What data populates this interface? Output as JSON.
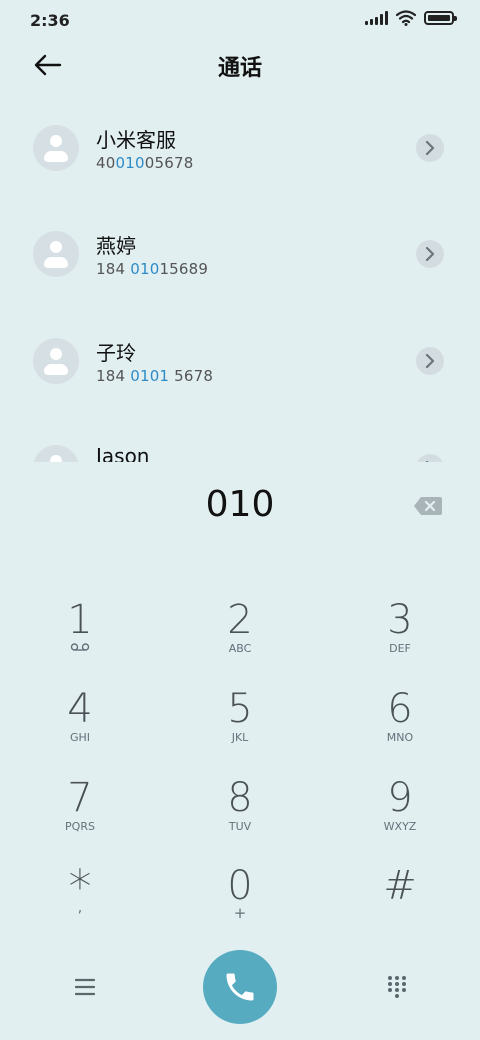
{
  "status_bar": {
    "time": "2:36",
    "battery_level": 1.0
  },
  "header": {
    "title": "通话"
  },
  "contacts": [
    {
      "name": "小米客服",
      "number_pre": "40",
      "number_hl": "010",
      "number_post": "05678"
    },
    {
      "name": "燕婷",
      "number_pre": "184 ",
      "number_hl": "010",
      "number_post": "15689"
    },
    {
      "name": "子玲",
      "number_pre": "184 ",
      "number_hl": "0101",
      "number_post": " 5678"
    },
    {
      "name": "Jason",
      "number_pre": "",
      "number_hl": "",
      "number_post": ""
    }
  ],
  "dialer": {
    "value": "010"
  },
  "keypad": [
    {
      "digit": "1",
      "letters": ""
    },
    {
      "digit": "2",
      "letters": "ABC"
    },
    {
      "digit": "3",
      "letters": "DEF"
    },
    {
      "digit": "4",
      "letters": "GHI"
    },
    {
      "digit": "5",
      "letters": "JKL"
    },
    {
      "digit": "6",
      "letters": "MNO"
    },
    {
      "digit": "7",
      "letters": "PQRS"
    },
    {
      "digit": "8",
      "letters": "TUV"
    },
    {
      "digit": "9",
      "letters": "WXYZ"
    },
    {
      "digit": "*",
      "letters": ","
    },
    {
      "digit": "0",
      "letters": "+"
    },
    {
      "digit": "#",
      "letters": ""
    }
  ],
  "icons": {
    "back": "arrow-left-icon",
    "voicemail": "voicemail-icon",
    "backspace": "backspace-icon",
    "menu": "menu-icon",
    "call": "phone-icon",
    "keypad_toggle": "dialpad-icon"
  },
  "colors": {
    "background": "#e1eff1",
    "accent": "#56abc0",
    "highlight": "#2e8bc7"
  }
}
